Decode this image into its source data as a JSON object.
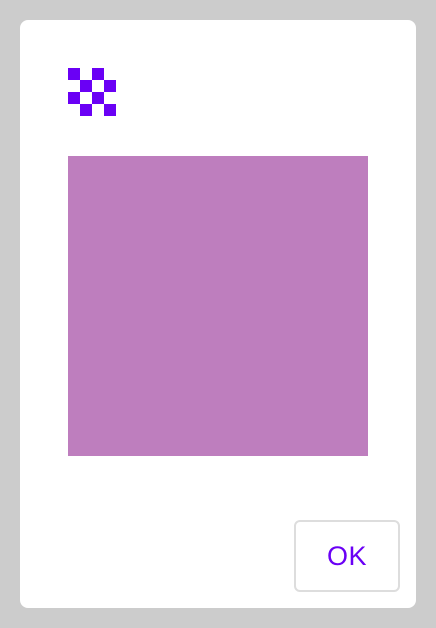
{
  "colors": {
    "backdrop": "#cccccc",
    "dialog_background": "#ffffff",
    "accent": "#6a00f5",
    "swatch": "#be7ebe",
    "button_border": "#dddddd"
  },
  "dialog": {
    "icon": "checkerboard-icon",
    "swatch_color": "#be7ebe",
    "ok_label": "OK"
  }
}
